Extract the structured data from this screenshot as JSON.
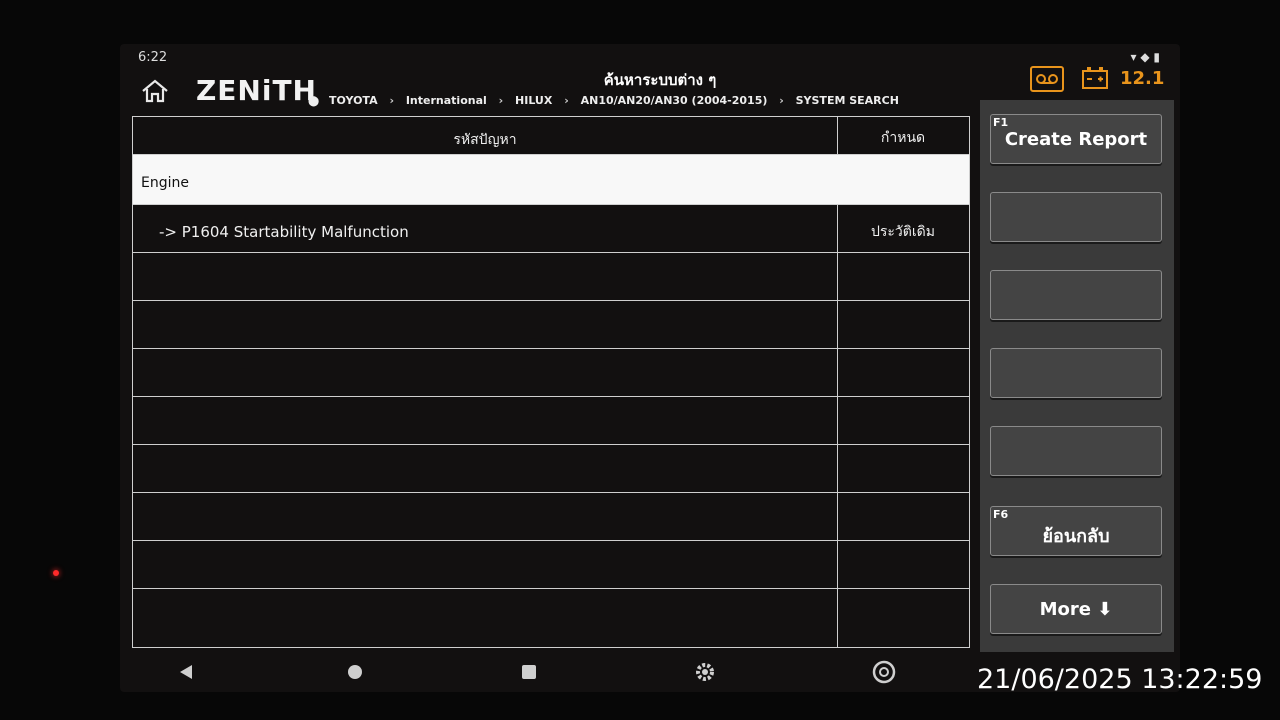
{
  "status_bar": {
    "time": "6:22"
  },
  "header": {
    "logo": "ZENiTH",
    "title": "ค้นหาระบบต่าง ๆ",
    "voltage": "12.1"
  },
  "breadcrumb": [
    "TOYOTA",
    "International",
    "HILUX",
    "AN10/AN20/AN30 (2004-2015)",
    "SYSTEM SEARCH"
  ],
  "table": {
    "columns": {
      "code": "รหัสปัญหา",
      "status": "กำหนด"
    },
    "group": "Engine",
    "rows": [
      {
        "code": "->  P1604 Startability Malfunction",
        "status": "ประวัติเดิม"
      }
    ]
  },
  "side_buttons": [
    {
      "fkey": "F1",
      "label": "Create Report"
    },
    {
      "fkey": "",
      "label": ""
    },
    {
      "fkey": "",
      "label": ""
    },
    {
      "fkey": "",
      "label": ""
    },
    {
      "fkey": "",
      "label": ""
    },
    {
      "fkey": "F6",
      "label": "ย้อนกลับ"
    },
    {
      "fkey": "",
      "label": "More ⬇"
    }
  ],
  "timestamp": "21/06/2025 13:22:59",
  "colors": {
    "accent": "#e8941c",
    "panel": "#3a3a3a",
    "background": "#121010"
  }
}
